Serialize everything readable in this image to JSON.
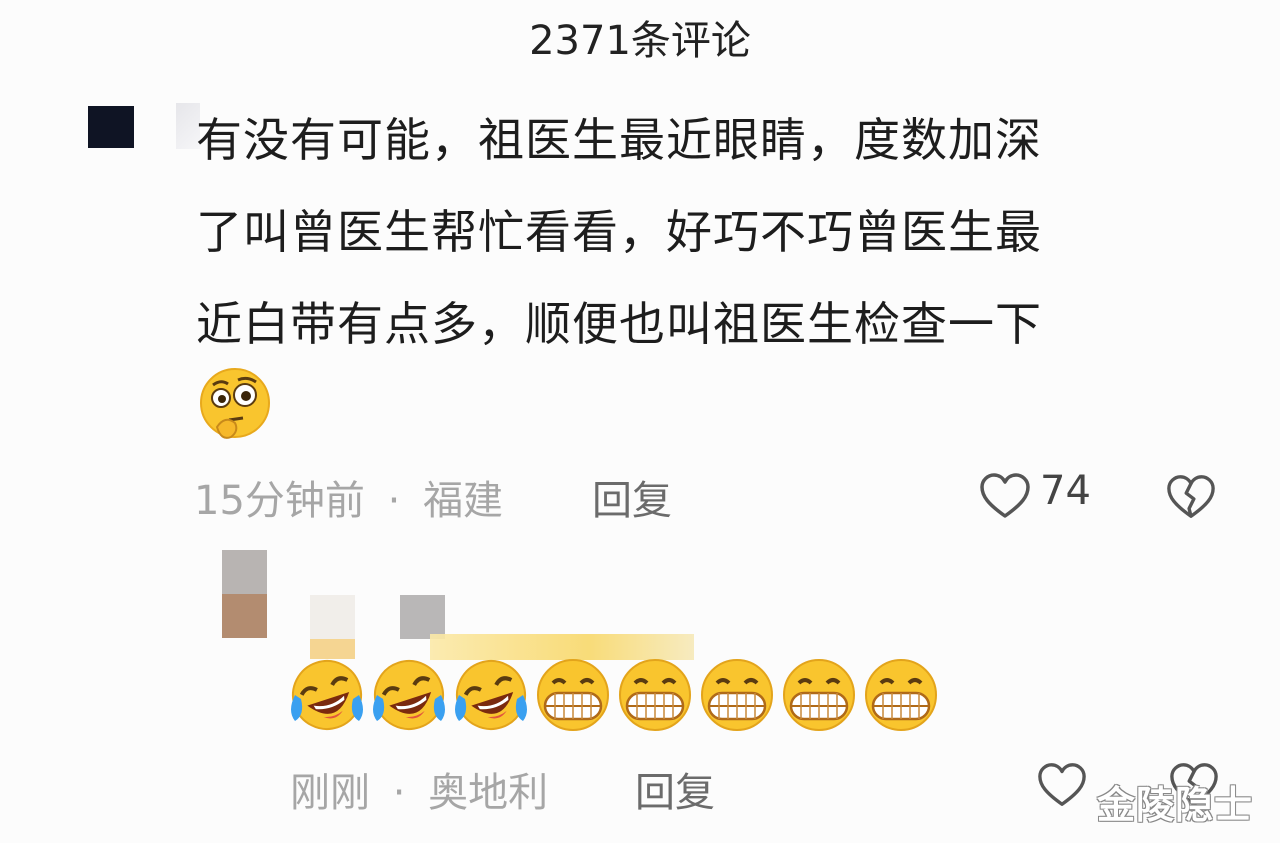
{
  "header": {
    "title": "2371条评论"
  },
  "comment": {
    "lines": [
      "有没有可能，祖医生最近眼睛，度数加深",
      "了叫曾医生帮忙看看，好巧不巧曾医生最",
      "近白带有点多，顺便也叫祖医生检查一下"
    ],
    "emoji": "thinking-face-emoji",
    "time": "15分钟前",
    "separator": "·",
    "location": "福建",
    "reply_label": "回复",
    "like_count": "74"
  },
  "reply": {
    "emojis": [
      "laugh-cry-emoji",
      "laugh-cry-emoji",
      "laugh-cry-emoji",
      "grin-emoji",
      "grin-emoji",
      "grin-emoji",
      "grin-emoji",
      "grin-emoji"
    ],
    "time": "刚刚",
    "separator": "·",
    "location": "奥地利",
    "reply_label": "回复"
  },
  "watermark": "金陵隐士",
  "colors": {
    "text_primary": "#1d1d1d",
    "text_meta": "#a6a6a6",
    "reply_label": "#6b6b6b",
    "emoji_yellow": "#f9c52e"
  }
}
